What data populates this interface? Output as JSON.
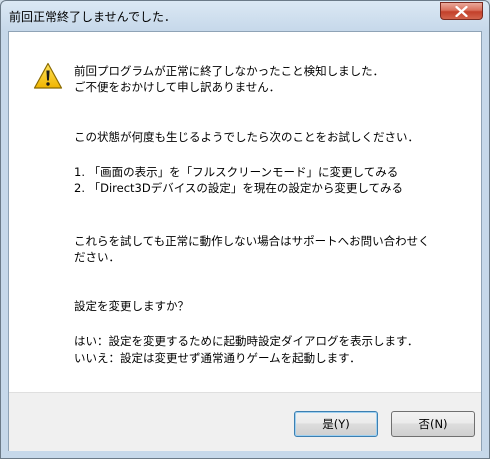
{
  "window": {
    "title": "前回正常終了しませんでした．"
  },
  "message": {
    "line1": "前回プログラムが正常に終了しなかったこと検知しました．",
    "line2": "ご不便をおかけして申し訳ありません．",
    "line3": "この状態が何度も生じるようでしたら次のことをお試しください．",
    "item1": "1. 「画面の表示」を「フルスクリーンモード」に変更してみる",
    "item2": "2. 「Direct3Dデバイスの設定」を現在の設定から変更してみる",
    "line4": "これらを試しても正常に動作しない場合はサポートへお問い合わせく",
    "line5": "ださい．",
    "question": "設定を変更しますか？",
    "yes_desc": "はい：設定を変更するために起動時設定ダイアログを表示します．",
    "no_desc": "いいえ：設定は変更せず通常通りゲームを起動します．"
  },
  "buttons": {
    "yes_label": "是(Y)",
    "no_label": "否(N)"
  },
  "icons": {
    "warning": "warning-icon",
    "close": "close-icon"
  },
  "colors": {
    "close_button": "#c84a33",
    "warning_fill": "#f5c400",
    "focus_border": "#3c7fb1"
  }
}
